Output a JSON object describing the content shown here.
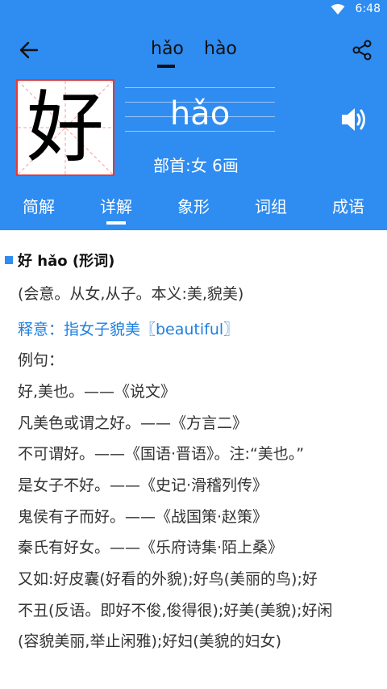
{
  "status_bar": {
    "time": "6:48"
  },
  "header": {
    "pinyin_tabs": [
      "hǎo",
      "hào"
    ],
    "selected_pinyin_index": 0,
    "character_accent": "好",
    "character": "好",
    "big_pinyin": "hǎo",
    "radical_info": "部首:女  6画",
    "icons": {
      "back": "back-arrow-icon",
      "share": "share-icon",
      "speaker": "speaker-icon"
    }
  },
  "tabs": [
    "简解",
    "详解",
    "象形",
    "词组",
    "成语"
  ],
  "selected_tab_index": 1,
  "content": {
    "heading": "好  hǎo (形词)",
    "lines": [
      {
        "text": "(会意。从女,从子。本义:美,貌美)",
        "style": "normal"
      },
      {
        "text": "释意：指女子貌美〖beautiful〗",
        "style": "blue"
      },
      {
        "text": "例句：",
        "style": "normal"
      },
      {
        "text": "好,美也。——《说文》",
        "style": "normal"
      },
      {
        "text": "凡美色或谓之好。——《方言二》",
        "style": "normal"
      },
      {
        "text": "不可谓好。——《国语·晋语》。注:“美也。”",
        "style": "normal"
      },
      {
        "text": "是女子不好。——《史记·滑稽列传》",
        "style": "normal"
      },
      {
        "text": "鬼侯有子而好。——《战国策·赵策》",
        "style": "normal"
      },
      {
        "text": "秦氏有好女。——《乐府诗集·陌上桑》",
        "style": "normal"
      },
      {
        "text": "又如:好皮囊(好看的外貌);好鸟(美丽的鸟);好",
        "style": "normal"
      },
      {
        "text": "不丑(反语。即好不俊,俊得很);好美(美貌);好闲",
        "style": "normal"
      },
      {
        "text": "(容貌美丽,举止闲雅);好妇(美貌的妇女)",
        "style": "normal"
      }
    ]
  },
  "colors": {
    "header_bg": "#2f8cf0",
    "accent_red": "#e53935",
    "link_blue": "#1e7fe0"
  }
}
